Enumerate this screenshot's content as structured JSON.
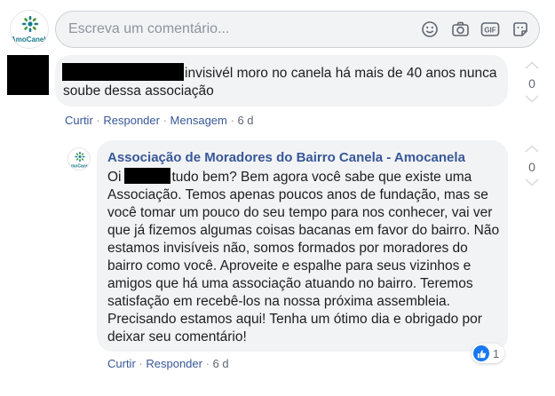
{
  "composer": {
    "placeholder": "Escreva um comentário...",
    "avatar_logo_text": "AmoCanela",
    "icons": [
      "emoji-icon",
      "camera-icon",
      "gif-icon",
      "sticker-icon"
    ],
    "gif_label": "GIF"
  },
  "comment1": {
    "text": "invisivél moro no canela há mais de 40 anos nunca soube dessa associação",
    "vote_count": "0",
    "actions": {
      "like": "Curtir",
      "reply": "Responder",
      "message": "Mensagem",
      "time": "6 d",
      "sep": "·"
    }
  },
  "reply": {
    "author": "Associação de Moradores do Bairro Canela - Amocanela",
    "body_start": "Oi",
    "body_rest": "tudo bem? Bem agora você sabe que existe uma Associação. Temos apenas poucos anos de fundação, mas se você tomar um pouco do seu tempo para nos conhecer, vai ver que já fizemos algumas coisas bacanas em favor do bairro. Não estamos invisíveis não, somos formados por moradores do bairro como você. Aproveite e espalhe para seus vizinhos e amigos que há uma associação atuando no bairro. Teremos satisfação em recebê-los na nossa próxima assembleia. Precisando estamos aqui! Tenha um ótimo dia e obrigado por deixar seu comentário!",
    "vote_count": "0",
    "reaction_count": "1",
    "actions": {
      "like": "Curtir",
      "reply": "Responder",
      "time": "6 d",
      "sep": "·"
    }
  },
  "colors": {
    "link": "#385898",
    "bubble": "#f2f3f5",
    "like_blue": "#1877f2",
    "logo_teal": "#1a7a8a",
    "logo_green": "#4a9a3a"
  }
}
